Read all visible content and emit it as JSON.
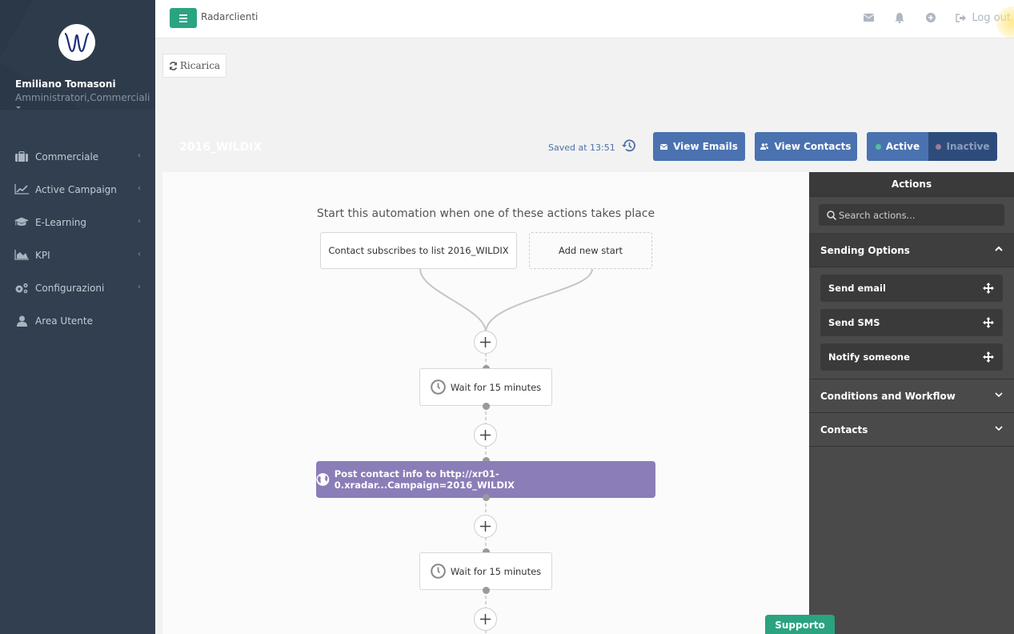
{
  "sidebar": {
    "user_name": "Emiliano Tomasoni",
    "user_role": "Amministratori,Commerciali",
    "items": [
      {
        "label": "Commerciale",
        "icon": "briefcase-icon",
        "has_submenu": true
      },
      {
        "label": "Active Campaign",
        "icon": "line-chart-icon",
        "has_submenu": true
      },
      {
        "label": "E-Learning",
        "icon": "graduation-cap-icon",
        "has_submenu": true
      },
      {
        "label": "KPI",
        "icon": "area-chart-icon",
        "has_submenu": true
      },
      {
        "label": "Configurazioni",
        "icon": "cogs-icon",
        "has_submenu": true
      },
      {
        "label": "Area Utente",
        "icon": "user-icon",
        "has_submenu": false
      }
    ]
  },
  "topbar": {
    "brand": "Radarclienti",
    "icons": [
      "envelope-icon",
      "bell-icon",
      "plus-circle-icon"
    ],
    "logout_label": "Log out"
  },
  "toolbar": {
    "reload_label": "Ricarica"
  },
  "automation": {
    "title": "2016_WILDIX",
    "saved_text": "Saved at 13:51",
    "view_emails_label": "View Emails",
    "view_contacts_label": "View Contacts",
    "status_active_label": "Active",
    "status_inactive_label": "Inactive",
    "status": "active",
    "colors": {
      "active_dot": "#4fc29a",
      "inactive_dot": "#a07a9a",
      "primary": "#4b72b0"
    }
  },
  "canvas": {
    "start_label": "Start this automation when one of these actions takes place",
    "trigger": "Contact subscribes to list 2016_WILDIX",
    "add_start_label": "Add new start",
    "steps": [
      {
        "type": "wait",
        "label": "Wait for 15 minutes"
      },
      {
        "type": "webhook",
        "label": "Post contact info to http://xr01-0.xradar...Campaign=2016_WILDIX"
      },
      {
        "type": "wait",
        "label": "Wait for 15 minutes"
      }
    ]
  },
  "actions_panel": {
    "title": "Actions",
    "search_placeholder": "Search actions...",
    "sections": [
      {
        "label": "Sending Options",
        "expanded": true,
        "items": [
          "Send email",
          "Send SMS",
          "Notify someone"
        ]
      },
      {
        "label": "Conditions and Workflow",
        "expanded": false
      },
      {
        "label": "Contacts",
        "expanded": false
      }
    ]
  },
  "support_label": "Supporto"
}
